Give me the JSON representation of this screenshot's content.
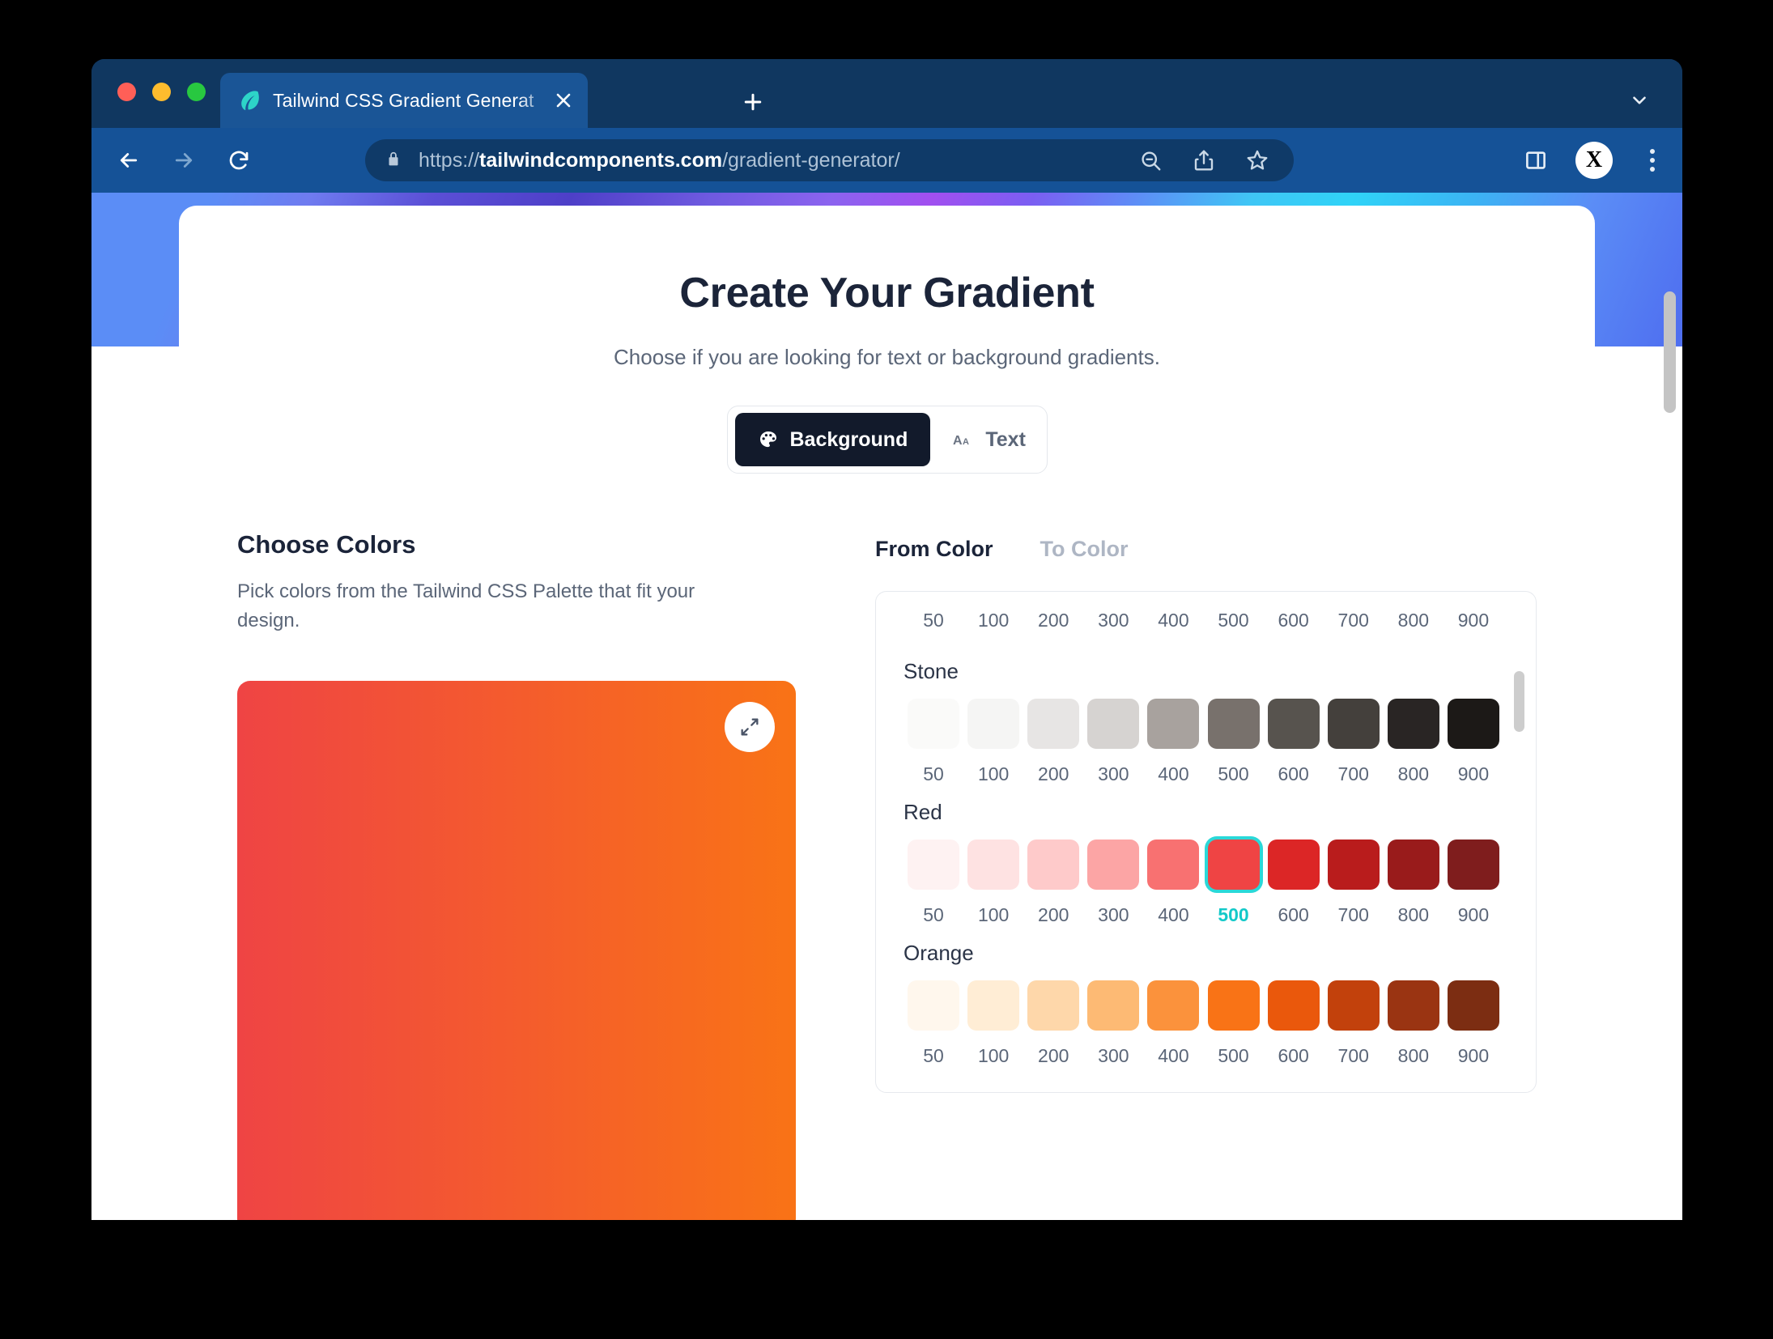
{
  "browser": {
    "tab": {
      "title": "Tailwind CSS Gradient Generat",
      "favicon": "leaf-icon",
      "close": "×",
      "new_tab": "+"
    },
    "toolbar": {
      "back": "back-arrow-icon",
      "forward": "forward-arrow-icon",
      "reload": "reload-icon",
      "lock": "lock-icon",
      "url_scheme": "https://",
      "url_domain": "tailwindcomponents.com",
      "url_path": "/gradient-generator/",
      "zoom_out": "zoom-out-icon",
      "share": "share-icon",
      "bookmark": "star-icon",
      "side_panel": "side-panel-icon",
      "profile_avatar": "X",
      "menu": "kebab-menu-icon",
      "tabstrip_chevron": "chevron-down-icon"
    }
  },
  "page": {
    "hero": {
      "title": "Create Your Gradient",
      "subtitle": "Choose if you are looking for text or background gradients."
    },
    "mode_toggle": {
      "background_label": "Background",
      "background_icon": "palette-icon",
      "text_label": "Text",
      "text_icon": "aa-icon",
      "active": "Background"
    },
    "choose_colors": {
      "heading": "Choose Colors",
      "description": "Pick colors from the Tailwind CSS Palette that fit your design.",
      "preview": {
        "from_hex": "#ef4444",
        "to_hex": "#f97316",
        "expand_icon": "expand-arrows-icon"
      },
      "tabs": [
        {
          "label": "From Color",
          "active": true
        },
        {
          "label": "To Color",
          "active": false
        }
      ],
      "shade_labels": [
        "50",
        "100",
        "200",
        "300",
        "400",
        "500",
        "600",
        "700",
        "800",
        "900"
      ],
      "selected": {
        "group": "Red",
        "shade": "500",
        "hex": "#ef4444"
      },
      "selection_ring_color": "#2ad8d8",
      "groups": [
        {
          "name": "Stone",
          "colors": [
            "#fafaf9",
            "#f5f5f4",
            "#e7e5e4",
            "#d6d3d1",
            "#a8a29e",
            "#78716c",
            "#57534e",
            "#44403c",
            "#292524",
            "#1c1917"
          ]
        },
        {
          "name": "Red",
          "colors": [
            "#fef2f2",
            "#fee2e2",
            "#fecaca",
            "#fca5a5",
            "#f87171",
            "#ef4444",
            "#dc2626",
            "#b91c1c",
            "#991b1b",
            "#7f1d1d"
          ]
        },
        {
          "name": "Orange",
          "colors": [
            "#fff7ed",
            "#ffedd5",
            "#fed7aa",
            "#fdba74",
            "#fb923c",
            "#f97316",
            "#ea580c",
            "#c2410c",
            "#9a3412",
            "#7c2d12"
          ]
        }
      ]
    }
  }
}
